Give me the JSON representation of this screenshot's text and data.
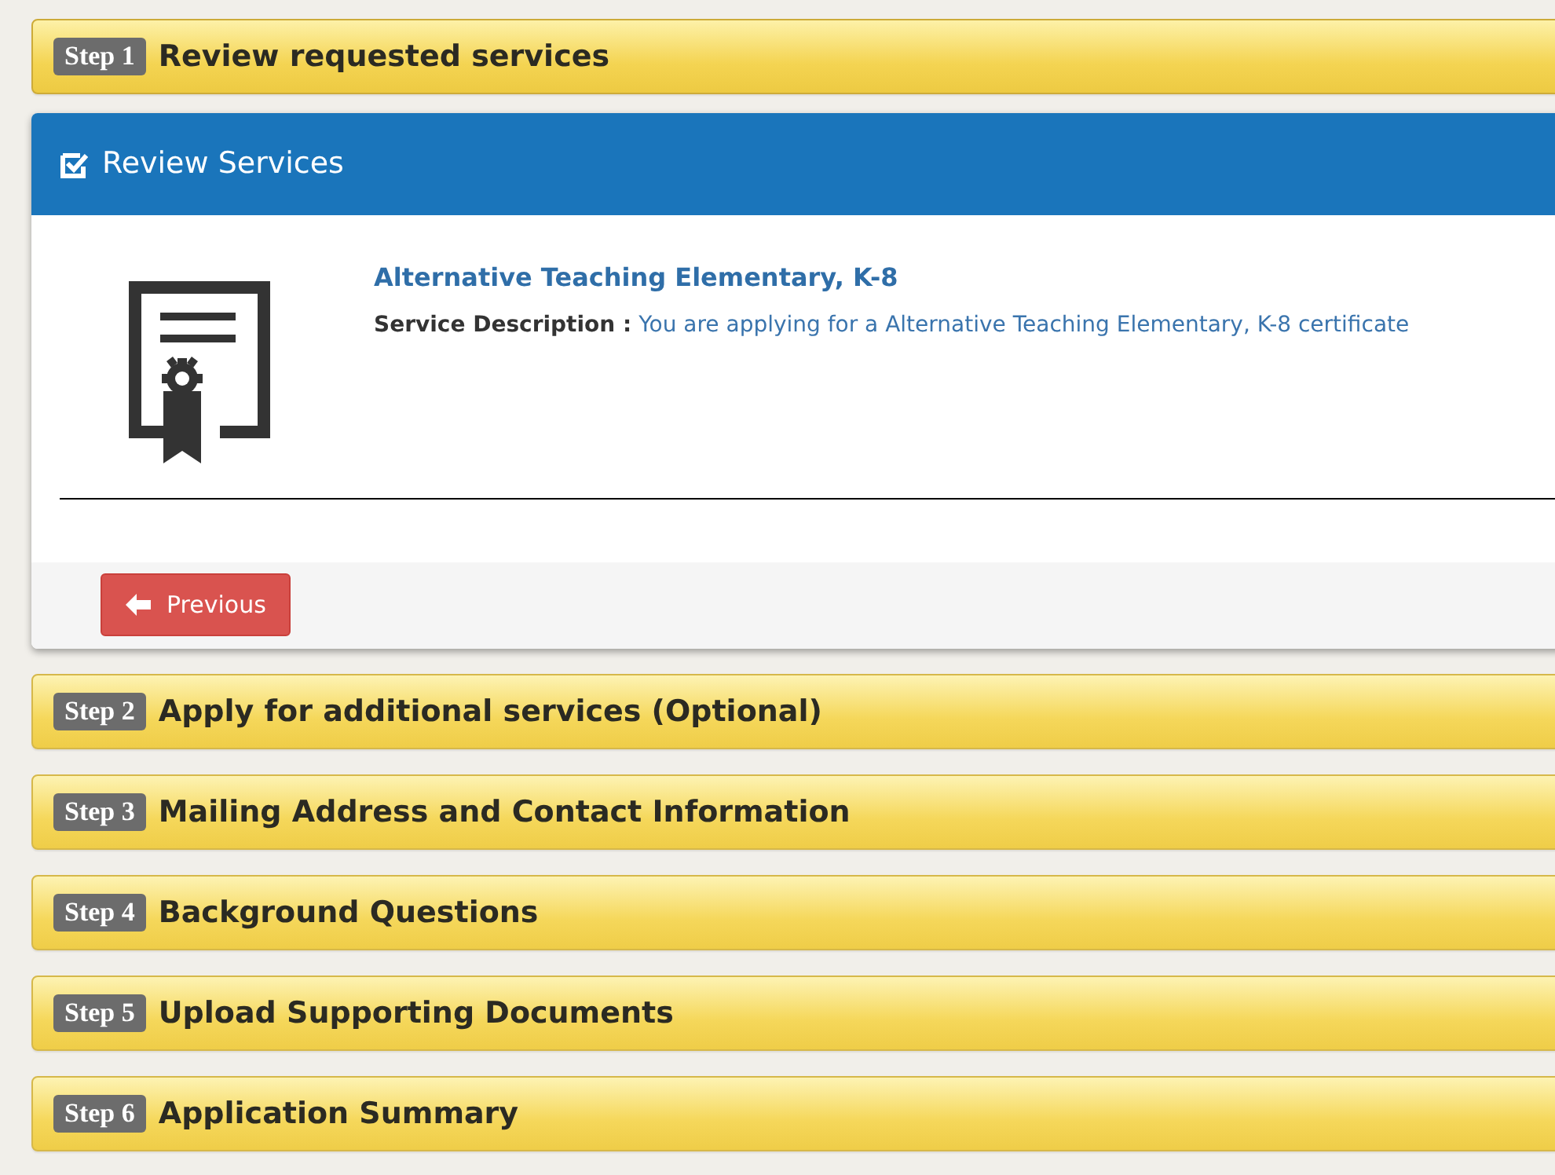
{
  "steps": [
    {
      "badge": "Step 1",
      "title": "Review requested services",
      "expanded": true
    },
    {
      "badge": "Step 2",
      "title": "Apply for additional services (Optional)",
      "expanded": false
    },
    {
      "badge": "Step 3",
      "title": "Mailing Address and Contact Information",
      "expanded": false
    },
    {
      "badge": "Step 4",
      "title": "Background Questions",
      "expanded": false
    },
    {
      "badge": "Step 5",
      "title": "Upload Supporting Documents",
      "expanded": false
    },
    {
      "badge": "Step 6",
      "title": "Application Summary",
      "expanded": false
    }
  ],
  "review_panel": {
    "heading": "Review Services",
    "service": {
      "name": "Alternative Teaching Elementary, K-8",
      "description_label": "Service Description :",
      "description": "You are applying for a Alternative Teaching Elementary, K-8 certificate"
    },
    "buttons": [
      {
        "label": "Previous",
        "kind": "back"
      }
    ]
  }
}
